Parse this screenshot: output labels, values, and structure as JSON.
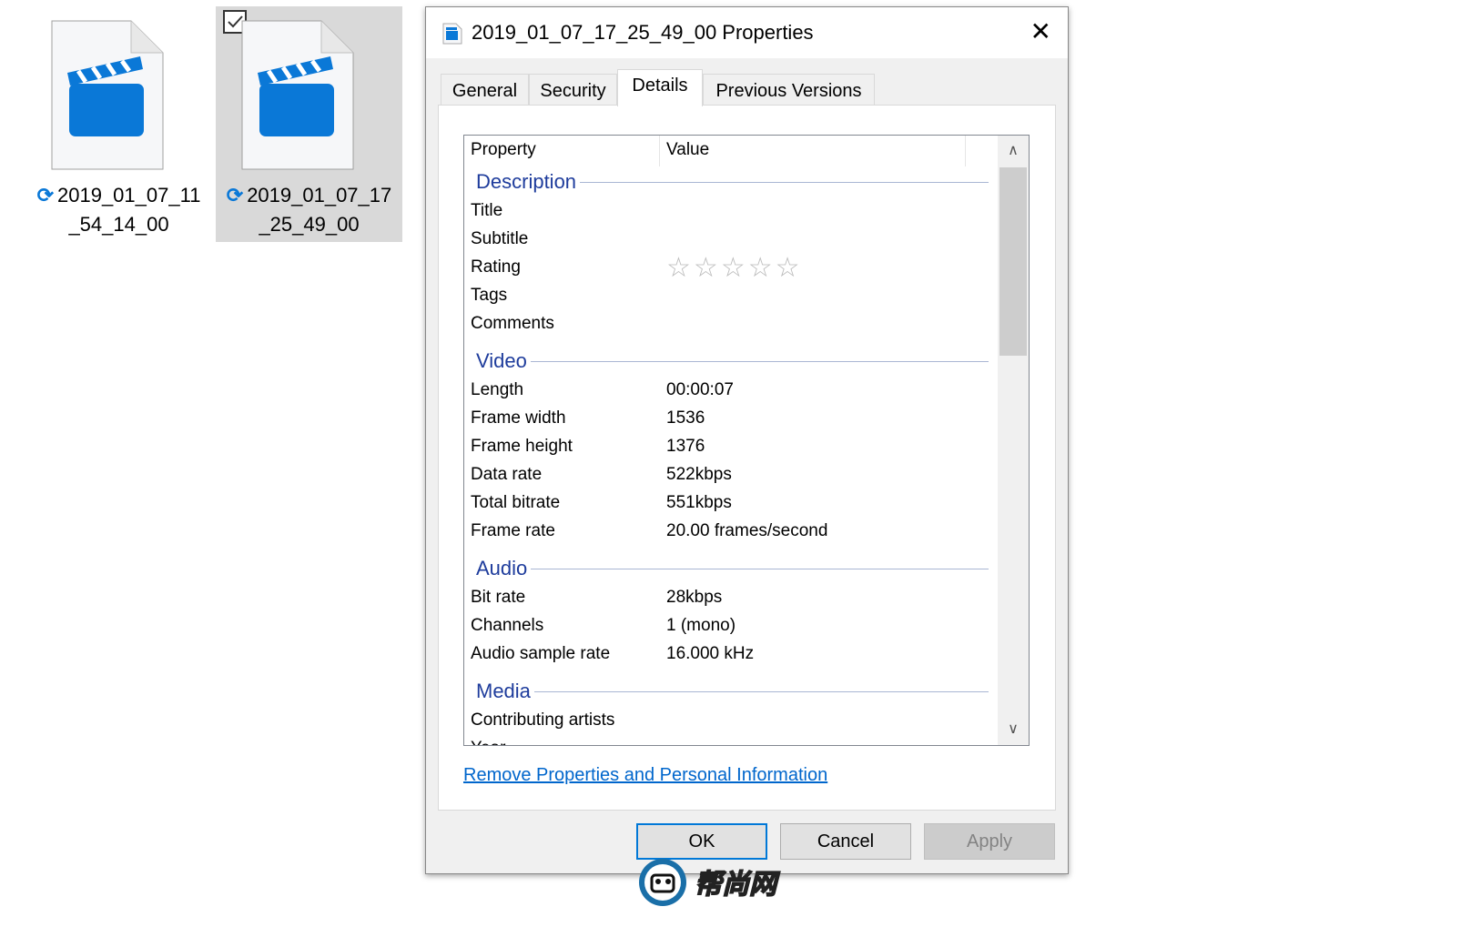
{
  "files": [
    {
      "name_line1": "2019_01_07_11",
      "name_line2": "_54_14_00",
      "selected": false
    },
    {
      "name_line1": "2019_01_07_17",
      "name_line2": "_25_49_00",
      "selected": true
    }
  ],
  "dialog": {
    "title": "2019_01_07_17_25_49_00 Properties",
    "tabs": [
      {
        "label": "General"
      },
      {
        "label": "Security"
      },
      {
        "label": "Details",
        "active": true
      },
      {
        "label": "Previous Versions"
      }
    ],
    "columns": {
      "property": "Property",
      "value": "Value"
    },
    "groups": [
      {
        "name": "Description",
        "rows": [
          {
            "k": "Title",
            "v": ""
          },
          {
            "k": "Subtitle",
            "v": ""
          },
          {
            "k": "Rating",
            "v": "",
            "stars": 0
          },
          {
            "k": "Tags",
            "v": ""
          },
          {
            "k": "Comments",
            "v": ""
          }
        ]
      },
      {
        "name": "Video",
        "rows": [
          {
            "k": "Length",
            "v": "00:00:07"
          },
          {
            "k": "Frame width",
            "v": "1536"
          },
          {
            "k": "Frame height",
            "v": "1376"
          },
          {
            "k": "Data rate",
            "v": "522kbps"
          },
          {
            "k": "Total bitrate",
            "v": "551kbps"
          },
          {
            "k": "Frame rate",
            "v": "20.00 frames/second"
          }
        ]
      },
      {
        "name": "Audio",
        "rows": [
          {
            "k": "Bit rate",
            "v": "28kbps"
          },
          {
            "k": "Channels",
            "v": "1 (mono)"
          },
          {
            "k": "Audio sample rate",
            "v": "16.000 kHz"
          }
        ]
      },
      {
        "name": "Media",
        "rows": [
          {
            "k": "Contributing artists",
            "v": ""
          },
          {
            "k": "Year",
            "v": ""
          }
        ]
      }
    ],
    "link": "Remove Properties and Personal Information",
    "buttons": {
      "ok": "OK",
      "cancel": "Cancel",
      "apply": "Apply"
    }
  },
  "colors": {
    "accent": "#0078d7",
    "group_header": "#1e3c9c",
    "icon_blue": "#0a78d7"
  }
}
